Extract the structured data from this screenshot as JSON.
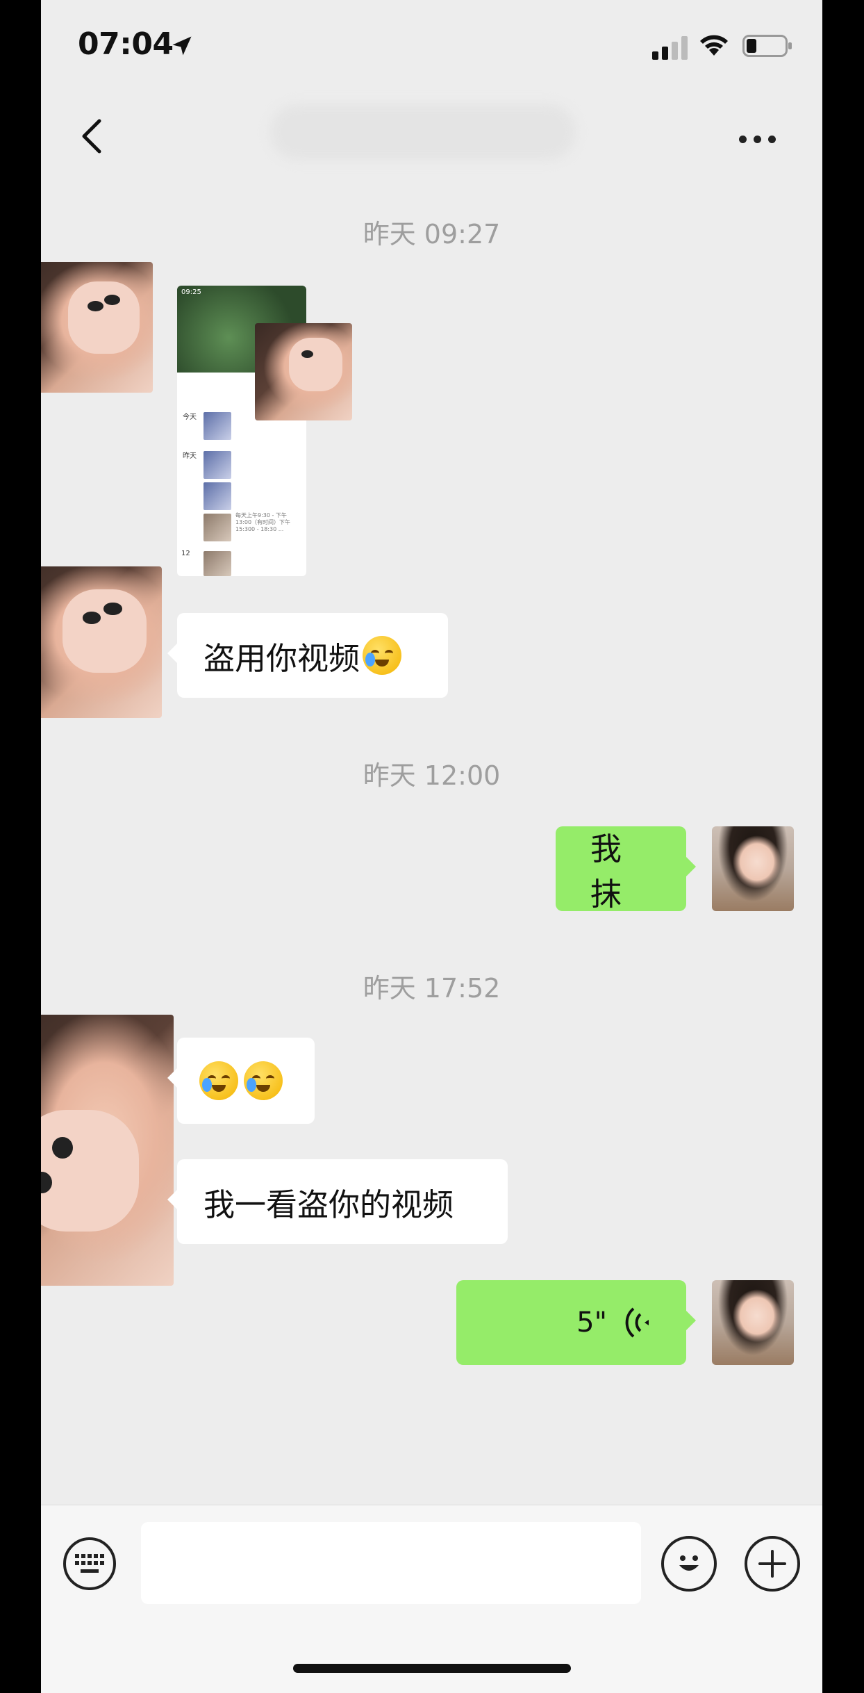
{
  "status_bar": {
    "time": "07:04"
  },
  "nav": {
    "title": ""
  },
  "timestamps": [
    "昨天 09:27",
    "昨天 12:00",
    "昨天 17:52"
  ],
  "messages": [
    {
      "side": "left",
      "type": "image"
    },
    {
      "side": "left",
      "type": "text",
      "text": "盗用你视频"
    },
    {
      "side": "right",
      "type": "text",
      "text": "我抹"
    },
    {
      "side": "left",
      "type": "emoji"
    },
    {
      "side": "left",
      "type": "text",
      "text": "我一看盗你的视频"
    },
    {
      "side": "right",
      "type": "voice",
      "duration": "5\""
    }
  ],
  "thumbnail": {
    "time": "09:25",
    "labels": [
      "今天",
      "昨天",
      "12"
    ],
    "note": "每天上午9:30 - 下午13:00（有时间）下午15:300 - 18:30 ..."
  },
  "input_bar": {
    "placeholder": ""
  },
  "icons": [
    "location-arrow-icon",
    "signal-icon",
    "wifi-icon",
    "battery-icon",
    "back-chevron-icon",
    "more-dots-icon",
    "keyboard-icon",
    "emoji-face-icon",
    "plus-icon",
    "voice-wave-icon"
  ]
}
